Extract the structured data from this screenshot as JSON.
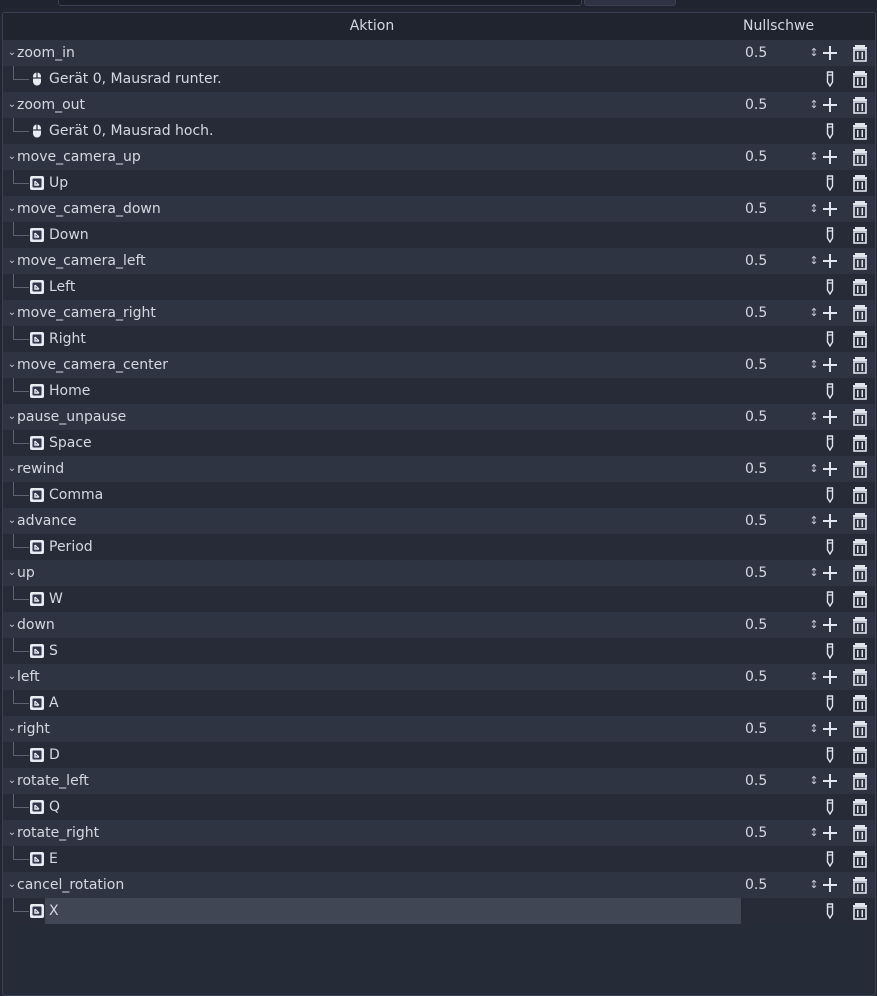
{
  "header": {
    "action_label": "Aktion",
    "deadzone_label": "Nullschwe"
  },
  "actions": [
    {
      "name": "zoom_in",
      "deadzone": "0.5",
      "event": {
        "type": "mouse",
        "label": "Gerät 0, Mausrad runter."
      }
    },
    {
      "name": "zoom_out",
      "deadzone": "0.5",
      "event": {
        "type": "mouse",
        "label": "Gerät 0, Mausrad hoch."
      }
    },
    {
      "name": "move_camera_up",
      "deadzone": "0.5",
      "event": {
        "type": "key",
        "label": "Up"
      }
    },
    {
      "name": "move_camera_down",
      "deadzone": "0.5",
      "event": {
        "type": "key",
        "label": "Down"
      }
    },
    {
      "name": "move_camera_left",
      "deadzone": "0.5",
      "event": {
        "type": "key",
        "label": "Left"
      }
    },
    {
      "name": "move_camera_right",
      "deadzone": "0.5",
      "event": {
        "type": "key",
        "label": "Right"
      }
    },
    {
      "name": "move_camera_center",
      "deadzone": "0.5",
      "event": {
        "type": "key",
        "label": "Home"
      }
    },
    {
      "name": "pause_unpause",
      "deadzone": "0.5",
      "event": {
        "type": "key",
        "label": "Space"
      }
    },
    {
      "name": "rewind",
      "deadzone": "0.5",
      "event": {
        "type": "key",
        "label": "Comma"
      }
    },
    {
      "name": "advance",
      "deadzone": "0.5",
      "event": {
        "type": "key",
        "label": "Period"
      }
    },
    {
      "name": "up",
      "deadzone": "0.5",
      "event": {
        "type": "key",
        "label": "W"
      }
    },
    {
      "name": "down",
      "deadzone": "0.5",
      "event": {
        "type": "key",
        "label": "S"
      }
    },
    {
      "name": "left",
      "deadzone": "0.5",
      "event": {
        "type": "key",
        "label": "A"
      }
    },
    {
      "name": "right",
      "deadzone": "0.5",
      "event": {
        "type": "key",
        "label": "D"
      }
    },
    {
      "name": "rotate_left",
      "deadzone": "0.5",
      "event": {
        "type": "key",
        "label": "Q"
      }
    },
    {
      "name": "rotate_right",
      "deadzone": "0.5",
      "event": {
        "type": "key",
        "label": "E"
      }
    },
    {
      "name": "cancel_rotation",
      "deadzone": "0.5",
      "event": {
        "type": "key",
        "label": "X",
        "selected": true
      }
    }
  ],
  "icons": {
    "toggle": "chevron-down-icon",
    "add": "add-icon",
    "edit": "pencil-icon",
    "remove": "trash-icon",
    "mouse": "mouse-icon",
    "key": "keyboard-key-icon",
    "spin": "spinner-arrows-icon"
  },
  "colors": {
    "background": "#222633",
    "action_row": "#2f3442",
    "event_row": "#272b37",
    "selected_row": "#414655",
    "text": "#d4d8e1"
  }
}
